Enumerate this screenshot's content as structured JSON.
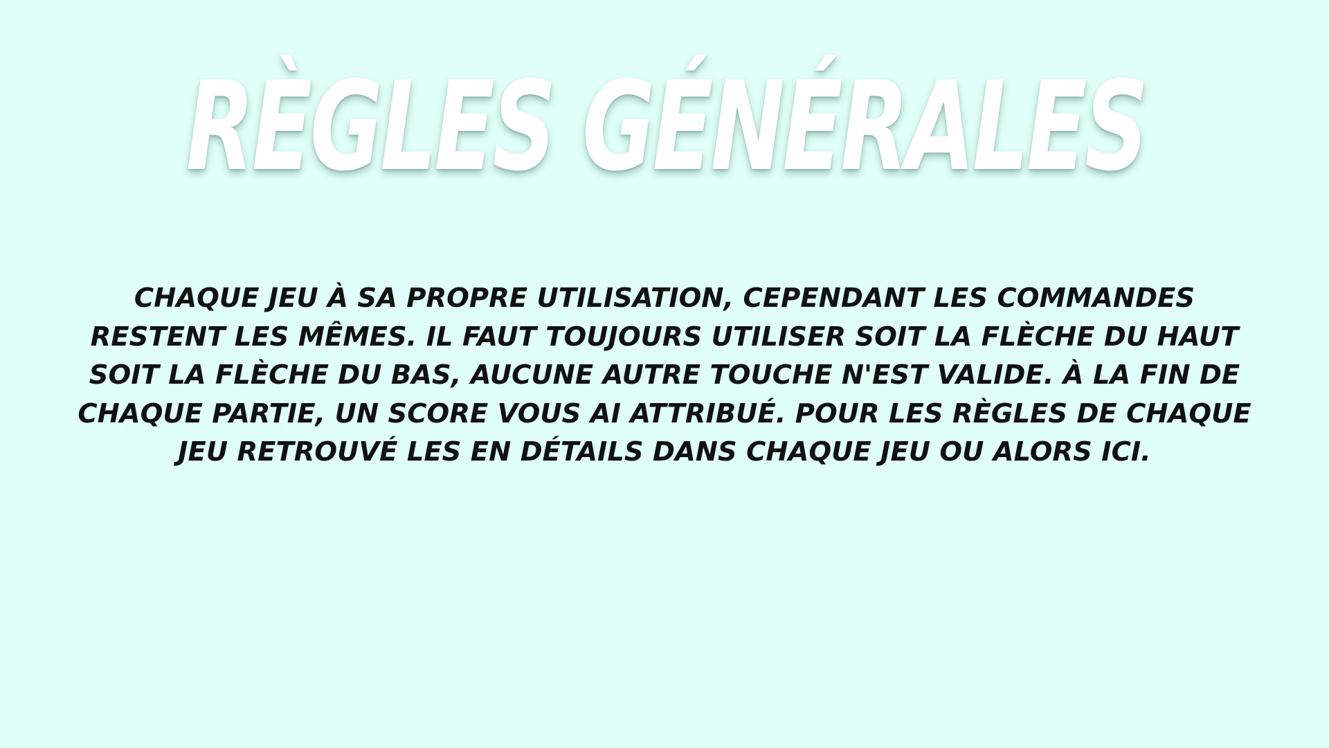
{
  "page": {
    "background_color": "#dffff8",
    "title_color": "#ffffff",
    "text_color": "#111111"
  },
  "title": "RÈGLES GÉNÉRALES",
  "rules_lines": [
    "CHAQUE JEU À SA PROPRE UTILISATION, CEPENDANT LES COMMANDES",
    "RESTENT LES MÊMES. IL FAUT TOUJOURS UTILISER SOIT LA FLÈCHE DU HAUT",
    "SOIT LA FLÈCHE DU BAS, AUCUNE AUTRE TOUCHE N'EST VALIDE. À LA FIN DE",
    "CHAQUE PARTIE, UN SCORE VOUS AI ATTRIBUÉ. POUR LES RÈGLES DE CHAQUE",
    "JEU RETROUVÉ LES EN DÉTAILS DANS CHAQUE JEU OU ALORS ICI."
  ]
}
